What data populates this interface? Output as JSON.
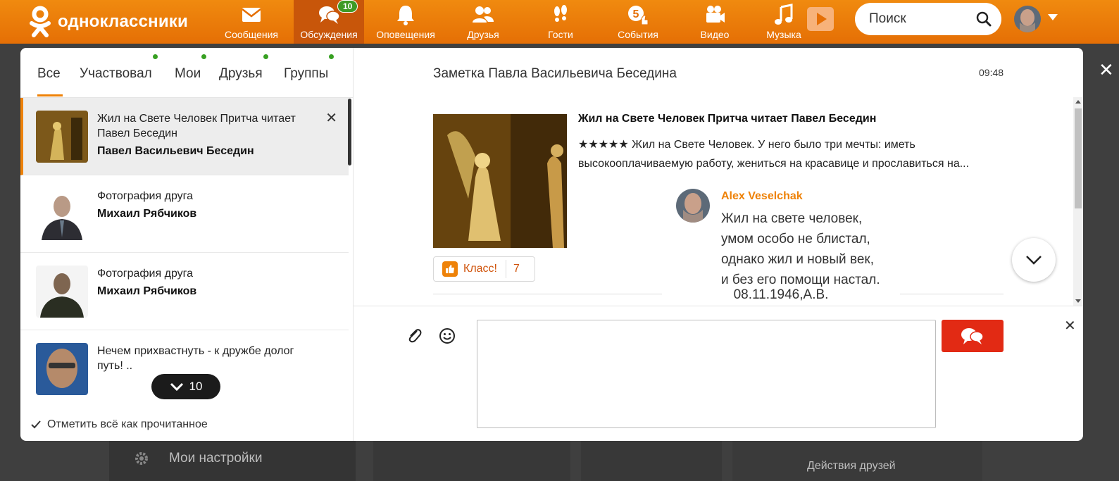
{
  "topbar": {
    "logo_text": "одноклассники",
    "nav": [
      {
        "label": "Сообщения",
        "icon": "envelope-icon"
      },
      {
        "label": "Обсуждения",
        "icon": "discussions-icon",
        "badge": "10"
      },
      {
        "label": "Оповещения",
        "icon": "bell-icon"
      },
      {
        "label": "Друзья",
        "icon": "friends-icon"
      },
      {
        "label": "Гости",
        "icon": "footprints-icon"
      },
      {
        "label": "События",
        "icon": "events-icon",
        "badge": "5"
      },
      {
        "label": "Видео",
        "icon": "video-camera-icon"
      },
      {
        "label": "Музыка",
        "icon": "music-note-icon"
      }
    ],
    "search_placeholder": "Поиск",
    "accent": "#ee8208"
  },
  "tabs": [
    "Все",
    "Участвовал",
    "Мои",
    "Друзья",
    "Группы"
  ],
  "conversations": [
    {
      "title": "Жил на Свете Человек Притча читает Павел Беседин",
      "name": "Павел Васильевич Беседин"
    },
    {
      "title": "Фотография друга",
      "name": "Михаил Рябчиков"
    },
    {
      "title": "Фотография друга",
      "name": "Михаил Рябчиков"
    },
    {
      "title": "Нечем прихвастнуть - к дружбе долог путь! ..",
      "name": ""
    }
  ],
  "more_count": "10",
  "mark_all_read": "Отметить всё как прочитанное",
  "chat": {
    "title": "Заметка Павла Васильевича Беседина",
    "time": "09:48",
    "note_title": "Жил на Свете Человек Притча читает Павел Беседин",
    "note_text": "★★★★★ Жил на Свете Человек. У него было три мечты: иметь высокооплачиваемую работу, жениться на красавице и прославиться на...",
    "klass_label": "Класс!",
    "klass_count": "7"
  },
  "comment": {
    "author": "Alex Veselchak",
    "lines": [
      "Жил на свете человек,",
      "умом особо не блистал,",
      "однако жил и новый век,",
      "и без его помощи настал."
    ],
    "signature": "08.11.1946,А.В."
  },
  "background": {
    "settings_label": "Мои настройки",
    "friends_actions": "Действия друзей"
  }
}
